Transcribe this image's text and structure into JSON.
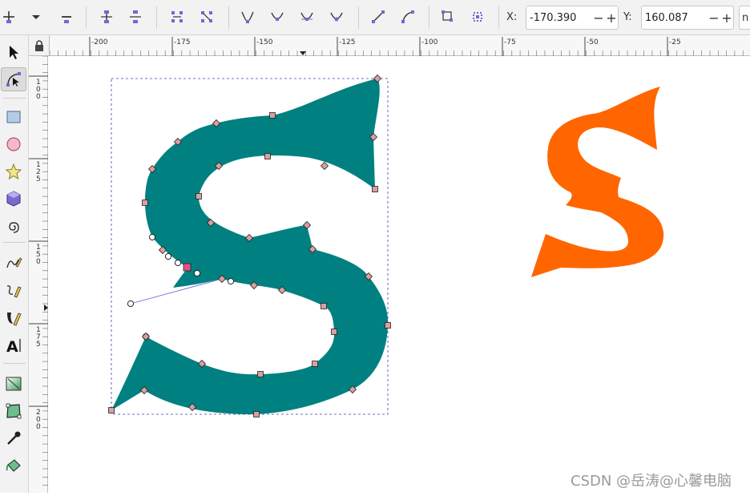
{
  "toolbar": {
    "x_label": "X:",
    "x_value": "-170.390",
    "y_label": "Y:",
    "y_value": "160.087",
    "minus": "−",
    "plus": "+",
    "overflow_label": "n",
    "icons": [
      "insert-node-icon",
      "dropdown-arrow-icon",
      "delete-node-icon",
      "join-nodes-icon",
      "break-path-icon",
      "join-segment-icon",
      "delete-segment-icon",
      "node-cusp-icon",
      "node-smooth-icon",
      "node-symmetric-icon",
      "node-auto-icon",
      "segment-line-icon",
      "segment-curve-icon",
      "object-to-path-icon",
      "stroke-to-path-icon"
    ]
  },
  "tools": [
    "selector-tool-icon",
    "node-tool-icon",
    "rectangle-tool-icon",
    "ellipse-tool-icon",
    "star-tool-icon",
    "3d-box-tool-icon",
    "spiral-tool-icon",
    "pencil-tool-icon",
    "pen-tool-icon",
    "calligraphy-tool-icon",
    "text-tool-icon",
    "gradient-tool-icon",
    "mesh-tool-icon",
    "dropper-tool-icon",
    "paint-bucket-tool-icon"
  ],
  "ruler": {
    "h_labels": [
      "-200",
      "-175",
      "-150",
      "-125",
      "-100",
      "-75",
      "-50",
      "-25"
    ],
    "v_labels": [
      "1\n0\n0",
      "1\n2\n5",
      "1\n5\n0",
      "1\n7\n5",
      "2\n0\n0"
    ]
  },
  "canvas": {
    "teal_color": "#008080",
    "orange_color": "#ff6600",
    "selection_color": "#4040a0"
  },
  "watermark": "CSDN @岳涛@心馨电脑"
}
